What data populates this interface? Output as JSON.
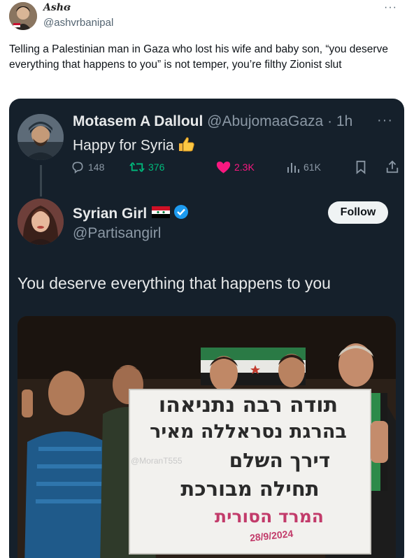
{
  "outer_tweet": {
    "display_name": "Ashɞ",
    "handle": "@ashvrbanipal",
    "more_icon": "ellipsis-icon",
    "text": "Telling a Palestinian man in Gaza who lost his wife and baby son, “you deserve everything that happens to you” is not temper, you’re filthy Zionist slut"
  },
  "quoted_tweet": {
    "display_name": "Motasem A Dalloul",
    "handle": "@AbujomaaGaza",
    "separator": " · ",
    "time": "1h",
    "text": "Happy for Syria",
    "actions": {
      "replies": "148",
      "retweets": "376",
      "likes": "2.3K",
      "views": "61K"
    },
    "colors": {
      "retweet": "#00ba7c",
      "like": "#f91880",
      "muted": "#8b98a5"
    }
  },
  "reply_tweet": {
    "display_name": "Syrian Girl",
    "handle": "@Partisangirl",
    "follow_label": "Follow",
    "text": "You deserve everything that happens to you",
    "verified_color": "#1d9bf0",
    "media": {
      "banner_lines": [
        "תודה רבה נתניאהו",
        "בהרגת נסראללה מאיר",
        "דירך השלם",
        "תחילה מבורכת",
        "המרד הסורית"
      ],
      "watermark": "@MoranT555",
      "date": "28/9/2024"
    }
  },
  "theme": {
    "card_bg": "#15202b",
    "text_light": "#e7e9ea",
    "accent_blue": "#1d9bf0"
  }
}
